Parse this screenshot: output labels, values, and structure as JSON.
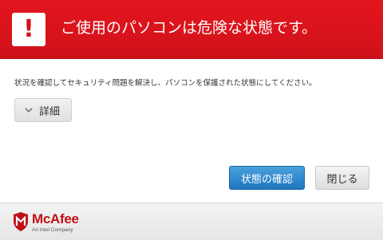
{
  "header": {
    "icon": "exclamation-icon",
    "alert_symbol": "!",
    "title": "ご使用のパソコンは危険な状態です。",
    "color": "#d4121b"
  },
  "body": {
    "message": "状況を確認してセキュリティ問題を解決し、パソコンを保護された状態にしてください。"
  },
  "details": {
    "icon": "chevron-down-icon",
    "label": "詳細"
  },
  "actions": {
    "confirm_label": "状態の確認",
    "close_label": "閉じる",
    "primary_color": "#2a86cf"
  },
  "footer": {
    "brand_icon": "mcafee-shield-icon",
    "brand_name": "McAfee",
    "tagline": "An Intel Company"
  }
}
